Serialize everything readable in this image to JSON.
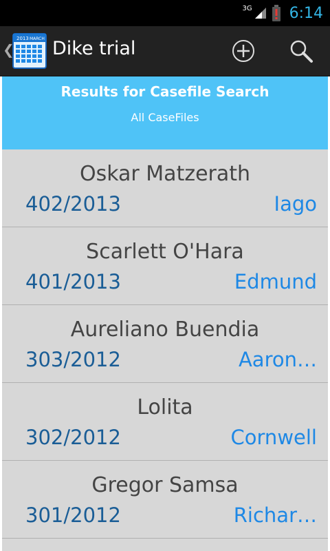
{
  "status_bar": {
    "network_label": "3G",
    "time": "6:14",
    "icons": [
      "signal-icon",
      "battery-alert-icon"
    ]
  },
  "action_bar": {
    "title": "Dike trial",
    "app_icon": "calendar-icon",
    "app_icon_year": "2013",
    "app_icon_month": "MARCH",
    "actions": [
      "add-circle-icon",
      "search-icon"
    ]
  },
  "list_header": {
    "title": "Results for Casefile Search",
    "subtitle": "All CaseFiles"
  },
  "rows": [
    {
      "name": "Oskar Matzerath",
      "number": "402/2013",
      "person": "Iago"
    },
    {
      "name": "Scarlett O'Hara",
      "number": "401/2013",
      "person": "Edmund"
    },
    {
      "name": "Aureliano Buendia",
      "number": "303/2012",
      "person": "Aaron…"
    },
    {
      "name": "Lolita",
      "number": "302/2012",
      "person": "Cornwell"
    },
    {
      "name": "Gregor Samsa",
      "number": "301/2012",
      "person": "Richar…"
    }
  ],
  "colors": {
    "accent": "#33b5e5",
    "header_band": "#4fc3f7",
    "list_bg": "#d7d7d7",
    "case_number": "#1a5d96",
    "person_link": "#1e88e5"
  }
}
